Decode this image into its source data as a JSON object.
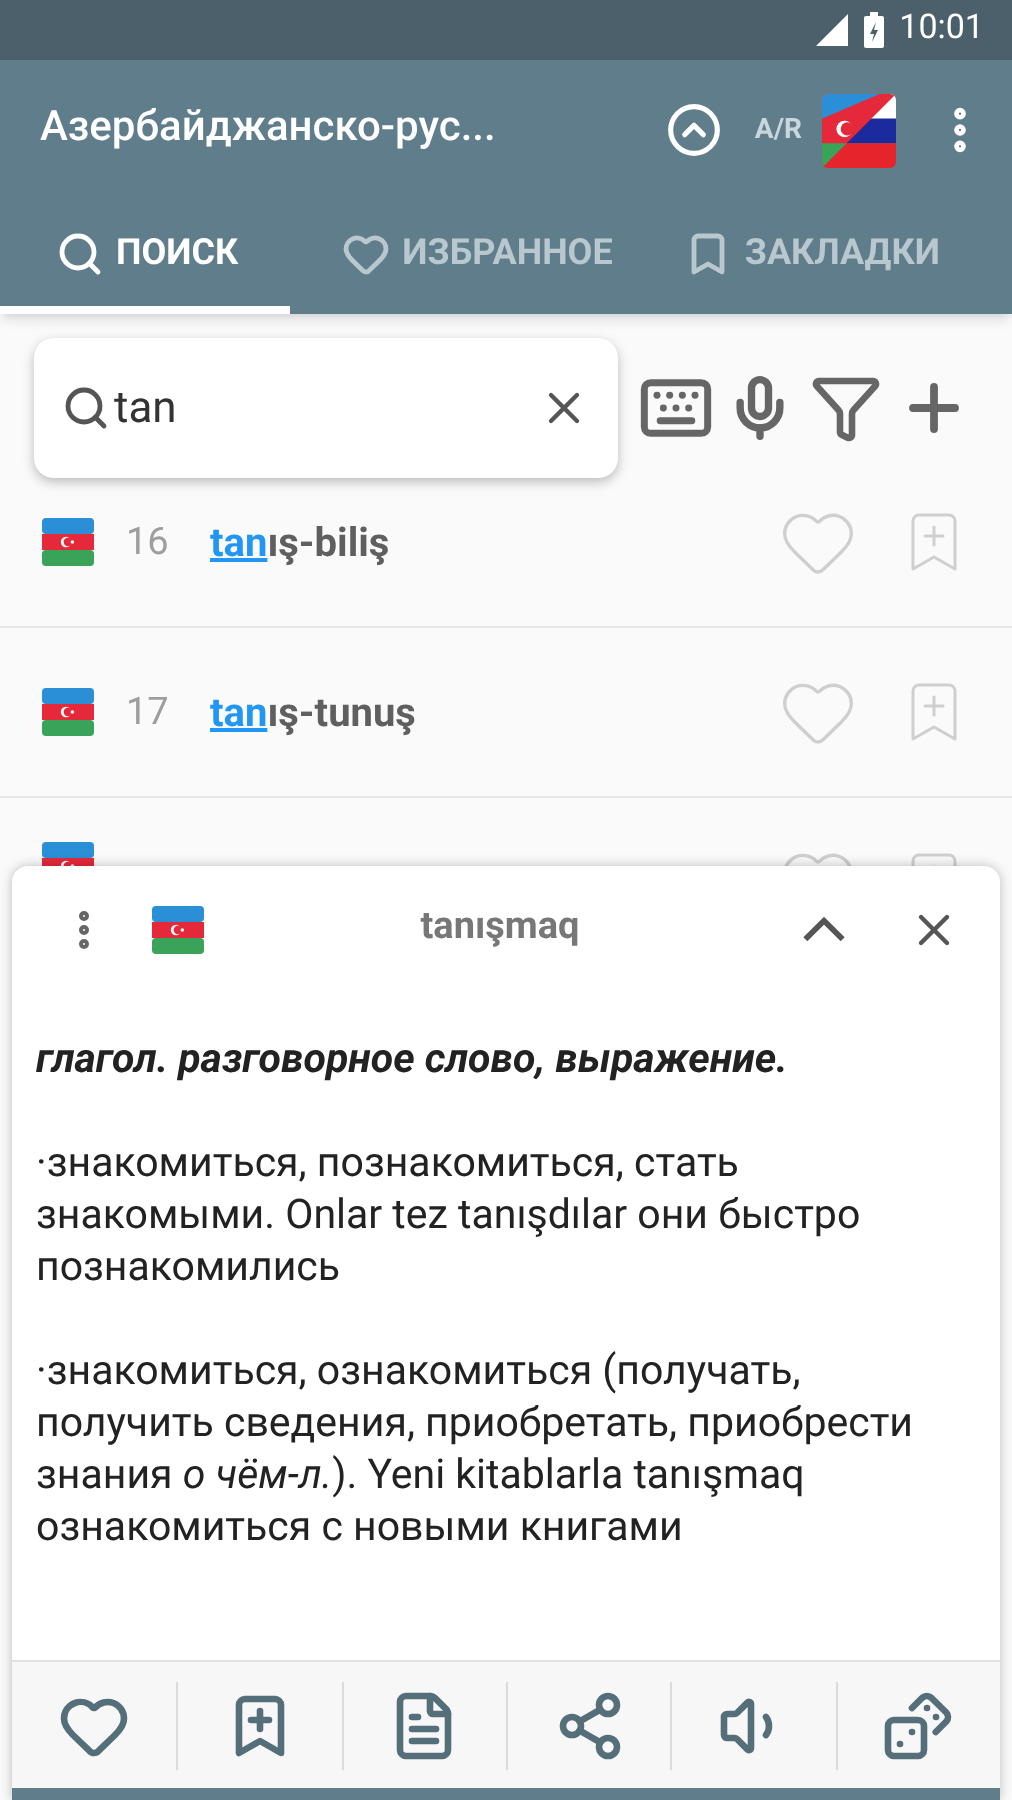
{
  "status_bar": {
    "time": "10:01"
  },
  "app_bar": {
    "title": "Азербайджанско-рус...",
    "direction": "A/R"
  },
  "tabs": [
    {
      "label": "ПОИСК",
      "selected": true
    },
    {
      "label": "ИЗБРАННОЕ",
      "selected": false
    },
    {
      "label": "ЗАКЛАДКИ",
      "selected": false
    }
  ],
  "search": {
    "value": "tan"
  },
  "rows": [
    {
      "number": "16",
      "match": "tan",
      "rest": "ış-biliş",
      "favorite": false,
      "bookmarked": false
    },
    {
      "number": "17",
      "match": "tan",
      "rest": "ış-tunuş",
      "favorite": false,
      "bookmarked": false
    }
  ],
  "card": {
    "title": "tanışmaq",
    "expanded": true,
    "header": "глагол. разговорное слово, выражение.",
    "senses": [
      "·знакомиться, познакомиться, стать знакомыми. Onlar tez tanışdılar они быстро познакомились",
      "·знакомиться, ознакомиться (получать, получить сведения, приобретать, приобрести знания *о чём-л.*). Yeni kitablarla tanışmaq ознакомиться с новыми книгами"
    ]
  }
}
